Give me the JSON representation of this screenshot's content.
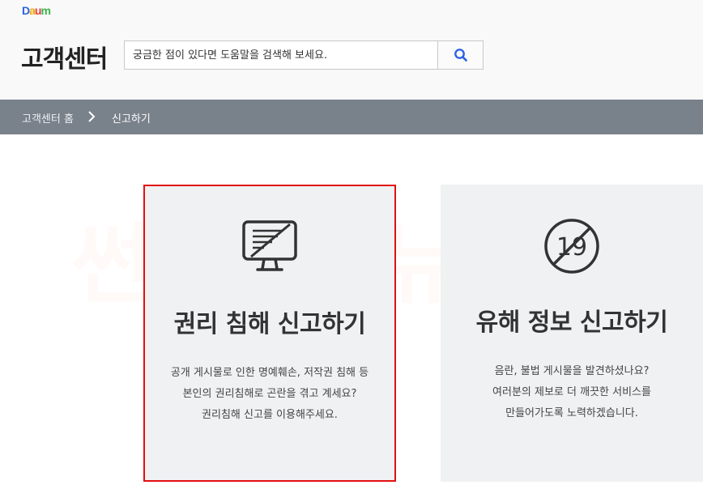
{
  "header": {
    "logo": [
      "D",
      "a",
      "u",
      "m"
    ],
    "title": "고객센터",
    "search_placeholder": "궁금한 점이 있다면 도움말을 검색해 보세요."
  },
  "breadcrumb": {
    "home": "고객센터 홈",
    "current": "신고하기"
  },
  "watermark": "썬티월대뉴설",
  "cards": [
    {
      "title": "권리 침해 신고하기",
      "icon": "monitor-icon",
      "lines": [
        "공개 게시물로 인한 명예훼손, 저작권 침해 등",
        "본인의 권리침해로 곤란을 겪고 계세요?",
        "권리침해 신고를 이용해주세요."
      ]
    },
    {
      "title": "유해 정보 신고하기",
      "icon": "no-19-icon",
      "badge": "19",
      "lines": [
        "음란, 불법 게시물을 발견하셨나요?",
        "여러분의 제보로 더 깨끗한 서비스를",
        "만들어가도록 노력하겠습니다."
      ]
    }
  ],
  "colors": {
    "accent": "#2b63e3",
    "nav": "#79818b",
    "selected_border": "#e01010",
    "card_bg": "#f0f1f3"
  }
}
